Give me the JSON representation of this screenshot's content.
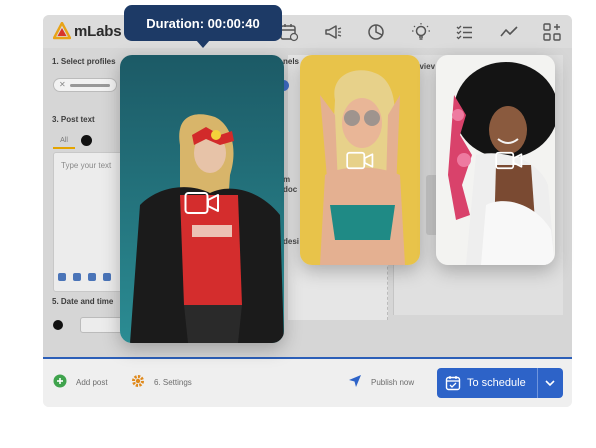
{
  "app": {
    "logo_text": "mLabs",
    "colors": {
      "brand_orange": "#e8a317",
      "brand_red": "#d9342b",
      "primary_blue": "#2d63c8",
      "tooltip_bg": "#1d3a66"
    }
  },
  "topnav": {
    "icons": [
      "calendar-icon",
      "megaphone-icon",
      "pie-chart-icon",
      "lightbulb-icon",
      "checklist-icon",
      "trend-line-icon",
      "grid-plus-icon"
    ]
  },
  "form": {
    "select_profiles_label": "1. Select profiles",
    "post_text_label": "3. Post text",
    "tab_all": "All",
    "textarea_placeholder": "Type your text",
    "date_time_label": "5. Date and time",
    "partial_channels": "nels",
    "partial_preview": "eviev",
    "partial_mid_1": "m",
    "partial_mid_2": "doc",
    "partial_mid_3": "desi"
  },
  "bottombar": {
    "add_post": "Add post",
    "settings": "6. Settings",
    "publish_now": "Publish now",
    "schedule": "To schedule"
  },
  "tooltip": {
    "text": "Duration: 00:00:40"
  },
  "media": [
    {
      "name": "video-card-1",
      "type": "video"
    },
    {
      "name": "video-card-2",
      "type": "video"
    },
    {
      "name": "video-card-3",
      "type": "video"
    }
  ]
}
